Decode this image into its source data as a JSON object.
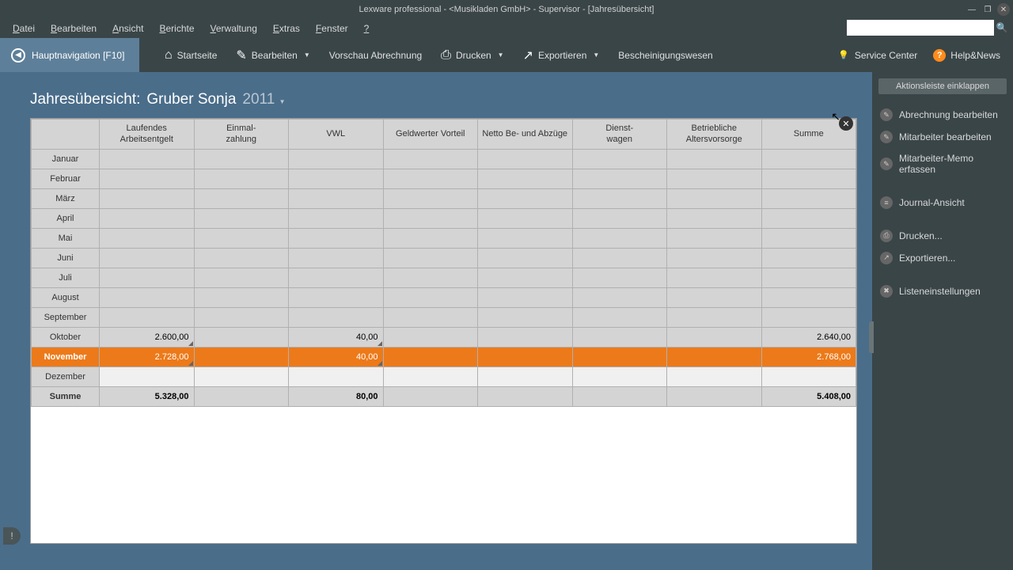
{
  "window": {
    "title": "Lexware professional - <Musikladen GmbH> - Supervisor - [Jahresübersicht]"
  },
  "menu": {
    "items": [
      "Datei",
      "Bearbeiten",
      "Ansicht",
      "Berichte",
      "Verwaltung",
      "Extras",
      "Fenster",
      "?"
    ]
  },
  "nav": {
    "label": "Hauptnavigation [F10]"
  },
  "toolbar": {
    "start": "Startseite",
    "edit": "Bearbeiten",
    "preview": "Vorschau Abrechnung",
    "print": "Drucken",
    "export": "Exportieren",
    "besch": "Bescheinigungswesen",
    "service": "Service Center",
    "help": "Help&News"
  },
  "page": {
    "title_prefix": "Jahresübersicht:",
    "person": "Gruber Sonja",
    "year": "2011"
  },
  "table": {
    "columns": [
      "",
      "Laufendes Arbeitsentgelt",
      "Einmal-\nzahlung",
      "VWL",
      "Geldwerter Vorteil",
      "Netto Be- und Abzüge",
      "Dienst-\nwagen",
      "Betriebliche Altersvorsorge",
      "Summe"
    ],
    "rows": [
      {
        "label": "Januar",
        "cells": [
          "",
          "",
          "",
          "",
          "",
          "",
          "",
          ""
        ]
      },
      {
        "label": "Februar",
        "cells": [
          "",
          "",
          "",
          "",
          "",
          "",
          "",
          ""
        ]
      },
      {
        "label": "März",
        "cells": [
          "",
          "",
          "",
          "",
          "",
          "",
          "",
          ""
        ]
      },
      {
        "label": "April",
        "cells": [
          "",
          "",
          "",
          "",
          "",
          "",
          "",
          ""
        ]
      },
      {
        "label": "Mai",
        "cells": [
          "",
          "",
          "",
          "",
          "",
          "",
          "",
          ""
        ]
      },
      {
        "label": "Juni",
        "cells": [
          "",
          "",
          "",
          "",
          "",
          "",
          "",
          ""
        ]
      },
      {
        "label": "Juli",
        "cells": [
          "",
          "",
          "",
          "",
          "",
          "",
          "",
          ""
        ]
      },
      {
        "label": "August",
        "cells": [
          "",
          "",
          "",
          "",
          "",
          "",
          "",
          ""
        ]
      },
      {
        "label": "September",
        "cells": [
          "",
          "",
          "",
          "",
          "",
          "",
          "",
          ""
        ]
      },
      {
        "label": "Oktober",
        "cells": [
          "2.600,00",
          "",
          "40,00",
          "",
          "",
          "",
          "",
          "2.640,00"
        ],
        "marks": [
          true,
          false,
          true,
          false,
          false,
          false,
          false,
          false
        ]
      },
      {
        "label": "November",
        "cells": [
          "2.728,00",
          "",
          "40,00",
          "",
          "",
          "",
          "",
          "2.768,00"
        ],
        "highlight": true,
        "marks": [
          true,
          false,
          true,
          false,
          false,
          false,
          false,
          false
        ]
      },
      {
        "label": "Dezember",
        "cells": [
          "",
          "",
          "",
          "",
          "",
          "",
          "",
          ""
        ],
        "dez": true
      }
    ],
    "sum": {
      "label": "Summe",
      "cells": [
        "5.328,00",
        "",
        "80,00",
        "",
        "",
        "",
        "",
        "5.408,00"
      ]
    }
  },
  "actions": {
    "collapse": "Aktionsleiste einklappen",
    "items": [
      {
        "icon": "✎",
        "label": "Abrechnung bearbeiten"
      },
      {
        "icon": "✎",
        "label": "Mitarbeiter bearbeiten"
      },
      {
        "icon": "✎",
        "label": "Mitarbeiter-Memo erfassen"
      },
      {
        "icon": "≡",
        "label": "Journal-Ansicht"
      },
      {
        "icon": "⎙",
        "label": "Drucken..."
      },
      {
        "icon": "↗",
        "label": "Exportieren..."
      },
      {
        "icon": "✖",
        "label": "Listeneinstellungen"
      }
    ]
  }
}
